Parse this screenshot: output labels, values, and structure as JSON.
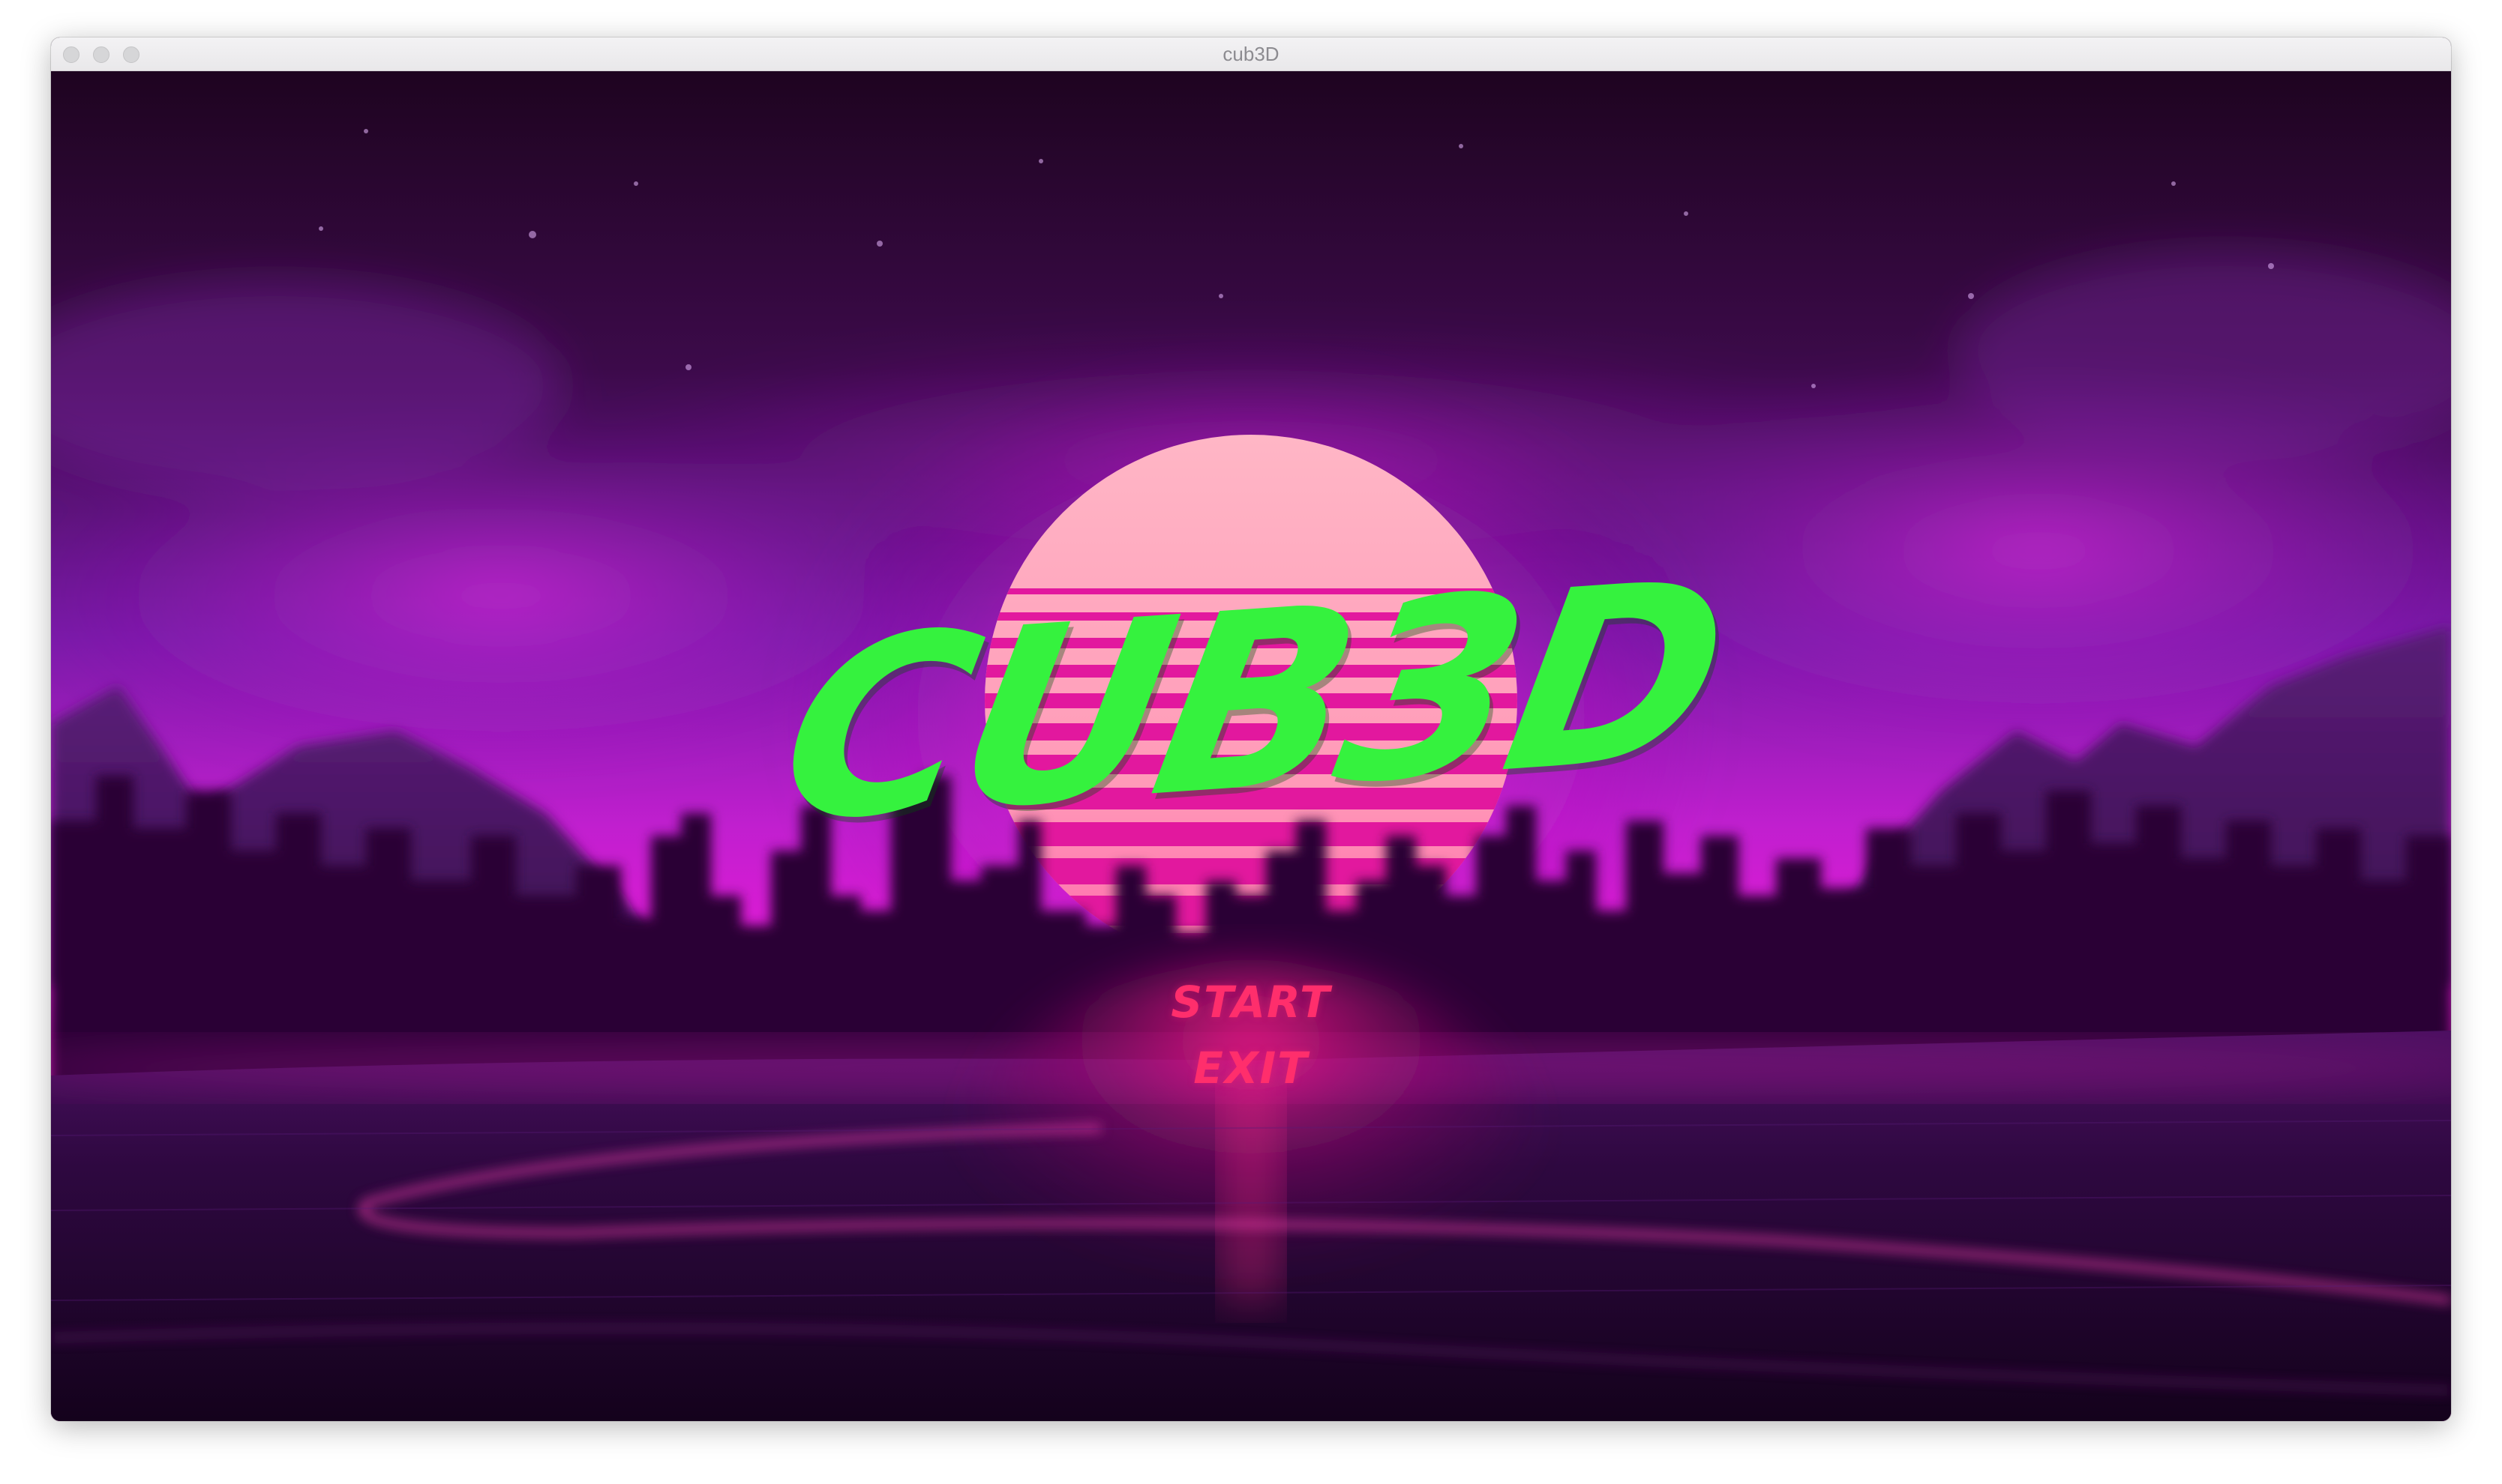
{
  "window": {
    "title": "cub3D"
  },
  "menu": {
    "logo": "CUB3D",
    "items": [
      {
        "label": "START"
      },
      {
        "label": "EXIT"
      }
    ]
  },
  "colors": {
    "logo": "#35f23e",
    "menu_text": "#ff2e6c",
    "sun_top": "#ffb0c4",
    "sky_dark": "#1e0420",
    "sky_purple": "#7a1aa8",
    "horizon_magenta": "#e41ad6"
  },
  "icons": {
    "traffic_close": "circle-gray",
    "traffic_minimize": "circle-gray",
    "traffic_zoom": "circle-gray"
  }
}
